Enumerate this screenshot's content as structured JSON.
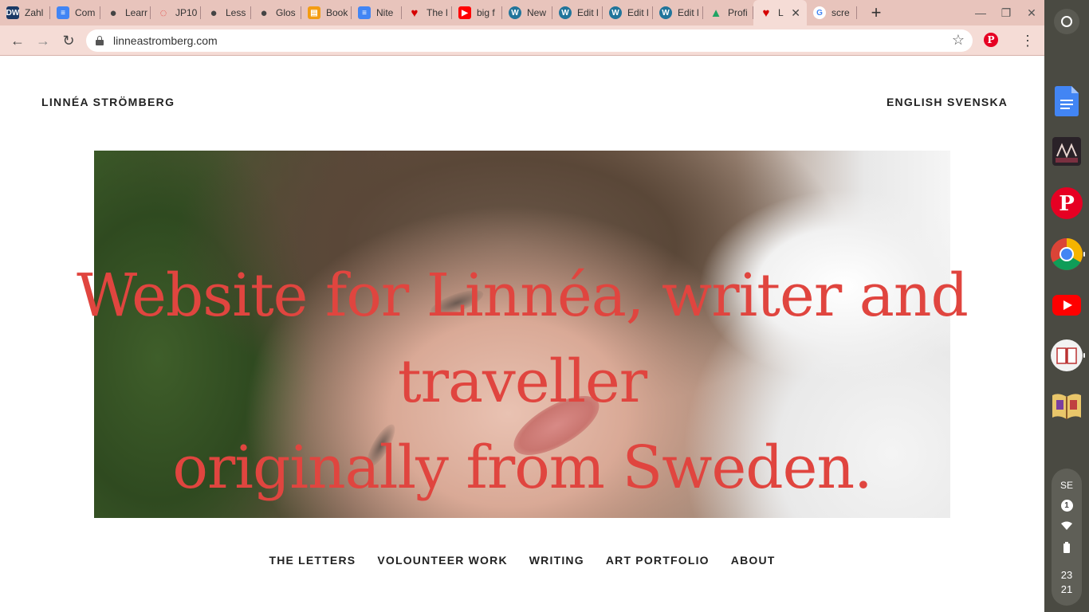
{
  "browser": {
    "tabs": [
      {
        "title": "Zahl",
        "icon": "dw-icon",
        "color": "#1a3a66"
      },
      {
        "title": "Com",
        "icon": "docs-icon",
        "color": "#4285f4"
      },
      {
        "title": "Learr",
        "icon": "globe-icon",
        "color": "#444444"
      },
      {
        "title": "JP10",
        "icon": "loading-icon",
        "color": "#e53935"
      },
      {
        "title": "Less",
        "icon": "globe-icon",
        "color": "#444444"
      },
      {
        "title": "Glos",
        "icon": "globe-icon",
        "color": "#444444"
      },
      {
        "title": "Book",
        "icon": "book-icon",
        "color": "#f39c12"
      },
      {
        "title": "Nite",
        "icon": "docs-icon",
        "color": "#4285f4"
      },
      {
        "title": "The l",
        "icon": "heart-icon",
        "color": "#d50000"
      },
      {
        "title": "big f",
        "icon": "youtube-icon",
        "color": "#ff0000"
      },
      {
        "title": "New",
        "icon": "wordpress-icon",
        "color": "#21759b"
      },
      {
        "title": "Edit l",
        "icon": "wordpress-icon",
        "color": "#21759b"
      },
      {
        "title": "Edit l",
        "icon": "wordpress-icon",
        "color": "#21759b"
      },
      {
        "title": "Edit l",
        "icon": "wordpress-icon",
        "color": "#21759b"
      },
      {
        "title": "Profi",
        "icon": "drive-icon",
        "color": "#1fa463"
      },
      {
        "title": "L",
        "icon": "heart-icon",
        "color": "#d50000",
        "active": true
      },
      {
        "title": "scre",
        "icon": "google-icon",
        "color": "#4285f4"
      }
    ],
    "new_tab_label": "+",
    "url": "linneastromberg.com"
  },
  "site": {
    "title": "LINNÉA STRÖMBERG",
    "languages": [
      "ENGLISH",
      "SVENSKA"
    ],
    "headline_line1": "Website for Linnéa, writer and traveller",
    "headline_line2": "originally from Sweden.",
    "headline_color": "#e0453f",
    "nav": [
      "THE LETTERS",
      "VOLOUNTEER WORK",
      "WRITING",
      "ART PORTFOLIO",
      "ABOUT"
    ]
  },
  "shelf": {
    "apps": [
      {
        "name": "google-docs-app-icon"
      },
      {
        "name": "gallery-app-icon"
      },
      {
        "name": "pinterest-app-icon"
      },
      {
        "name": "chrome-app-icon",
        "running": true
      },
      {
        "name": "youtube-app-icon"
      },
      {
        "name": "book-app-icon",
        "running": true
      },
      {
        "name": "storybook-app-icon"
      }
    ],
    "status": {
      "keyboard": "SE",
      "notifications": "1",
      "hour": "23",
      "minute": "21"
    }
  }
}
